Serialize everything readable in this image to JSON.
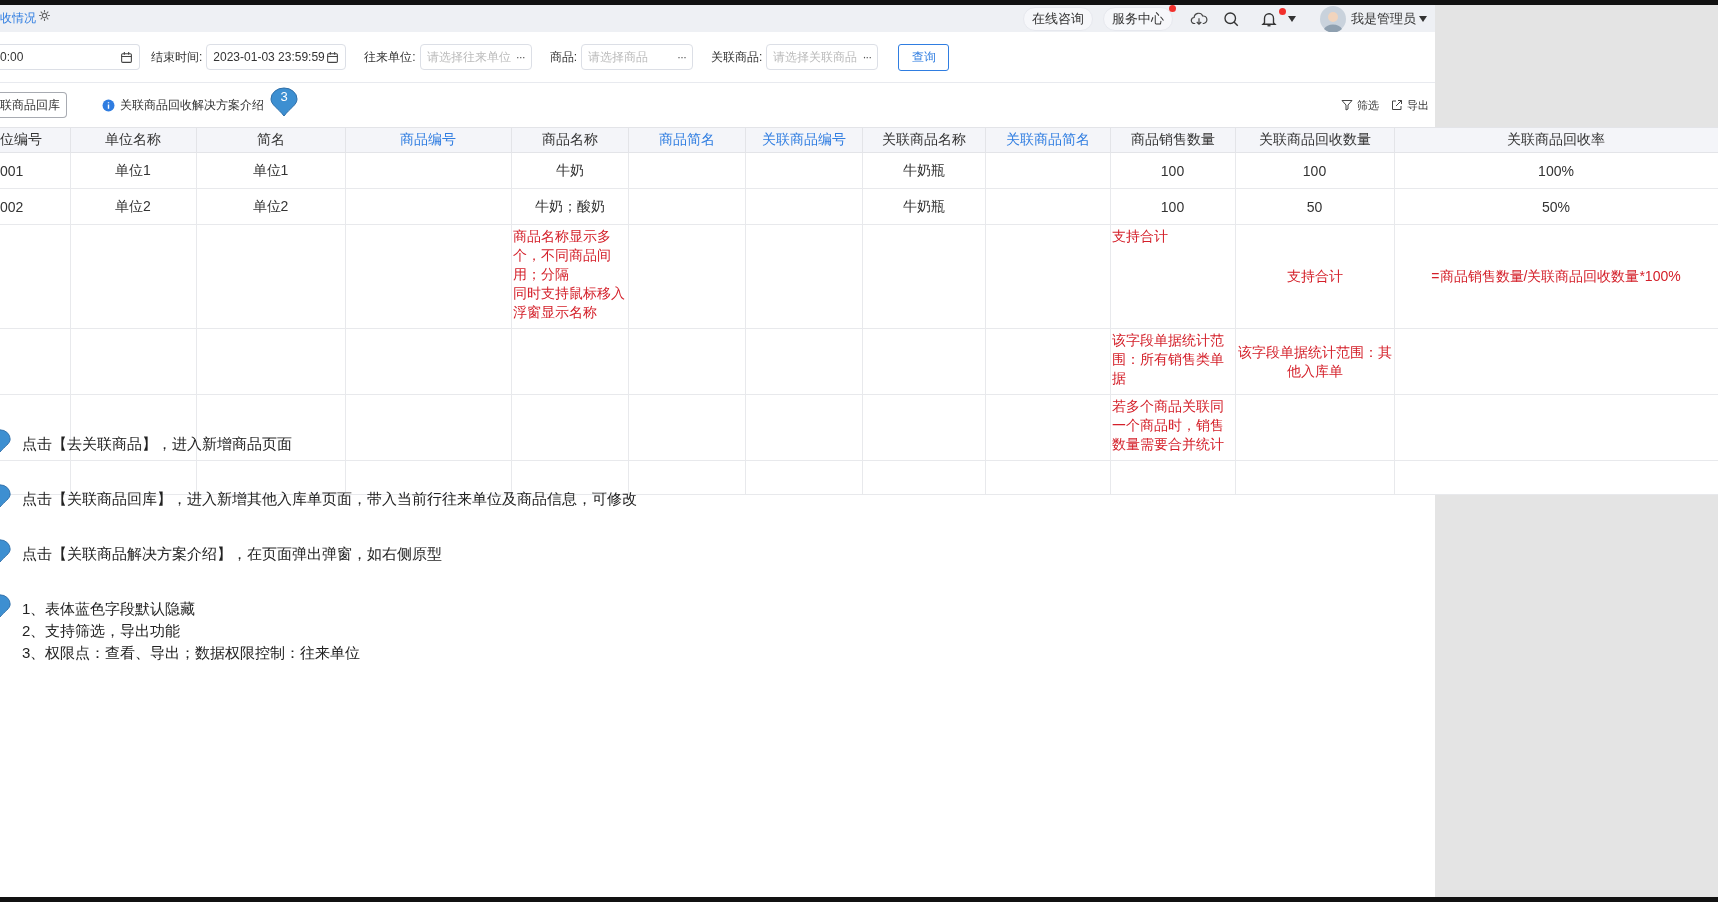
{
  "tab_title": "收情况",
  "top_bar": {
    "buttons": [
      {
        "label": "在线咨询",
        "badge": false
      },
      {
        "label": "服务中心",
        "badge": true
      }
    ],
    "notification_badge": true,
    "user": "我是管理员"
  },
  "filters": [
    {
      "kind": "date",
      "value": "0:00"
    },
    {
      "kind": "date",
      "label": "结束时间:",
      "value": "2023-01-03 23:59:59"
    },
    {
      "kind": "picker",
      "label": "往来单位:",
      "placeholder": "请选择往来单位"
    },
    {
      "kind": "picker",
      "label": "商品:",
      "placeholder": "请选择商品"
    },
    {
      "kind": "picker",
      "label": "关联商品:",
      "placeholder": "请选择关联商品"
    }
  ],
  "picker_more": "···",
  "query_button": "查询",
  "toolbar": {
    "return_button": "联商品回库",
    "info_link": "关联商品回收解决方案介绍",
    "info_marker": "3",
    "filter": "筛选",
    "export": "导出"
  },
  "table": {
    "columns": [
      {
        "label": "位编号",
        "highlight": false
      },
      {
        "label": "单位名称",
        "highlight": false
      },
      {
        "label": "简名",
        "highlight": false
      },
      {
        "label": "商品编号",
        "highlight": true
      },
      {
        "label": "商品名称",
        "highlight": false
      },
      {
        "label": "商品简名",
        "highlight": true
      },
      {
        "label": "关联商品编号",
        "highlight": true
      },
      {
        "label": "关联商品名称",
        "highlight": false
      },
      {
        "label": "关联商品简名",
        "highlight": true
      },
      {
        "label": "商品销售数量",
        "highlight": false
      },
      {
        "label": "关联商品回收数量",
        "highlight": false
      },
      {
        "label": "关联商品回收率",
        "highlight": false
      }
    ],
    "rows": [
      {
        "kind": "data",
        "cells": [
          "001",
          "单位1",
          "单位1",
          null,
          "牛奶",
          null,
          null,
          "牛奶瓶",
          null,
          "100",
          "100",
          "100%"
        ]
      },
      {
        "kind": "data",
        "cells": [
          "002",
          "单位2",
          "单位2",
          null,
          "牛奶；酸奶",
          null,
          null,
          "牛奶瓶",
          null,
          "100",
          "50",
          "50%"
        ]
      },
      {
        "kind": "note",
        "cells": [
          null,
          null,
          null,
          null,
          [
            "商品名称显示多个，不同商品间用；分隔",
            "同时支持鼠标移入浮窗显示名称"
          ],
          null,
          null,
          null,
          null,
          "支持合计",
          "支持合计",
          "=商品销售数量/关联商品回收数量*100%"
        ]
      },
      {
        "kind": "note",
        "cells": [
          null,
          null,
          null,
          null,
          null,
          null,
          null,
          null,
          null,
          "该字段单据统计范围：所有销售类单据",
          "该字段单据统计范围：其他入库单",
          null
        ]
      },
      {
        "kind": "note",
        "cells": [
          null,
          null,
          null,
          null,
          null,
          null,
          null,
          null,
          null,
          "若多个商品关联同一个商品时，销售数量需要合并统计",
          null,
          null
        ]
      },
      {
        "kind": "note",
        "cells": [
          null,
          null,
          null,
          null,
          null,
          null,
          null,
          null,
          null,
          null,
          null,
          null
        ]
      }
    ]
  },
  "notes": [
    {
      "lines": [
        "点击【去关联商品】，进入新增商品页面"
      ]
    },
    {
      "lines": [
        "点击【关联商品回库】，进入新增其他入库单页面，带入当前行往来单位及商品信息，可修改"
      ]
    },
    {
      "lines": [
        "点击【关联商品解决方案介绍】，在页面弹出弹窗，如右侧原型"
      ]
    },
    {
      "lines": [
        "1、表体蓝色字段默认隐藏",
        "2、支持筛选，导出功能",
        "3、权限点：查看、导出；数据权限控制：往来单位"
      ]
    }
  ]
}
